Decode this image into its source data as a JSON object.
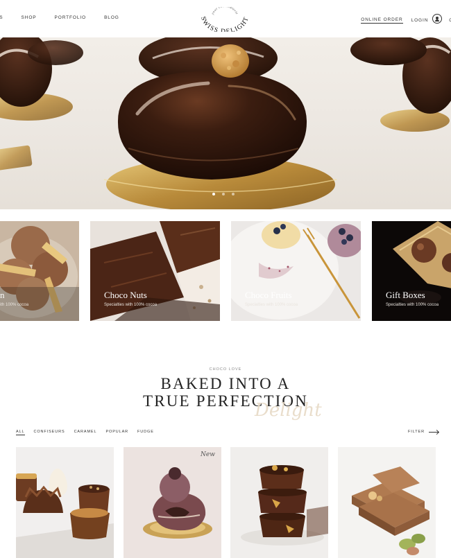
{
  "nav": {
    "left": [
      "ES",
      "SHOP",
      "PORTFOLIO",
      "BLOG"
    ],
    "online_order": "ONLINE ORDER",
    "login": "LOGIN",
    "right_cut": "C"
  },
  "logo": {
    "top_text": "your chocolaterie",
    "main_text": "SWISS DELIGHT"
  },
  "hero": {
    "slides": 3,
    "active_slide": 1
  },
  "categories": [
    {
      "title": "n",
      "subtitle": "ith 100% cocoa"
    },
    {
      "title": "Choco Nuts",
      "subtitle": "Specialties with 100% cocoa"
    },
    {
      "title": "Choco Fruits",
      "subtitle": "Specialties with 100% cocoa"
    },
    {
      "title": "Gift Boxes",
      "subtitle": "Specialties with 100% cocoa"
    }
  ],
  "section": {
    "eyebrow": "CHOCO LOVE",
    "line1": "BAKED INTO A",
    "line2": "TRUE PERFECTION",
    "script": "Delight"
  },
  "filters": [
    "ALL",
    "CONFISEURS",
    "CARAMEL",
    "POPULAR",
    "FUDGE"
  ],
  "filter_label": "FILTER",
  "products": [
    {
      "badge": ""
    },
    {
      "badge": "New"
    },
    {
      "badge": ""
    },
    {
      "badge": ""
    }
  ],
  "colors": {
    "text": "#222222",
    "chocolate": "#3a1f12",
    "gold": "#c9a45a",
    "script": "#e2d3bd"
  }
}
